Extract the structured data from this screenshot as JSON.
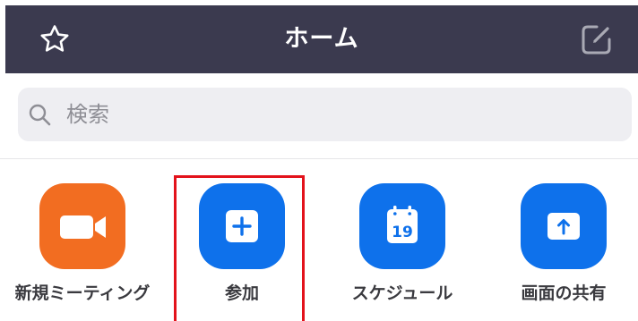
{
  "header": {
    "title": "ホーム",
    "background_color": "#3b3a4f",
    "left_icon": "star-icon",
    "right_icon": "edit-icon"
  },
  "search": {
    "placeholder": "検索",
    "icon": "search-icon"
  },
  "actions": [
    {
      "label": "新規ミーティング",
      "icon": "video-camera-icon",
      "color": "#f26d21"
    },
    {
      "label": "参加",
      "icon": "plus-icon",
      "color": "#0e71eb"
    },
    {
      "label": "スケジュール",
      "icon": "calendar-icon",
      "color": "#0e71eb",
      "calendar_day": "19"
    },
    {
      "label": "画面の共有",
      "icon": "share-screen-icon",
      "color": "#0e71eb"
    }
  ],
  "annotation": {
    "highlight_color": "#e3121b",
    "highlighted_action": "参加"
  }
}
